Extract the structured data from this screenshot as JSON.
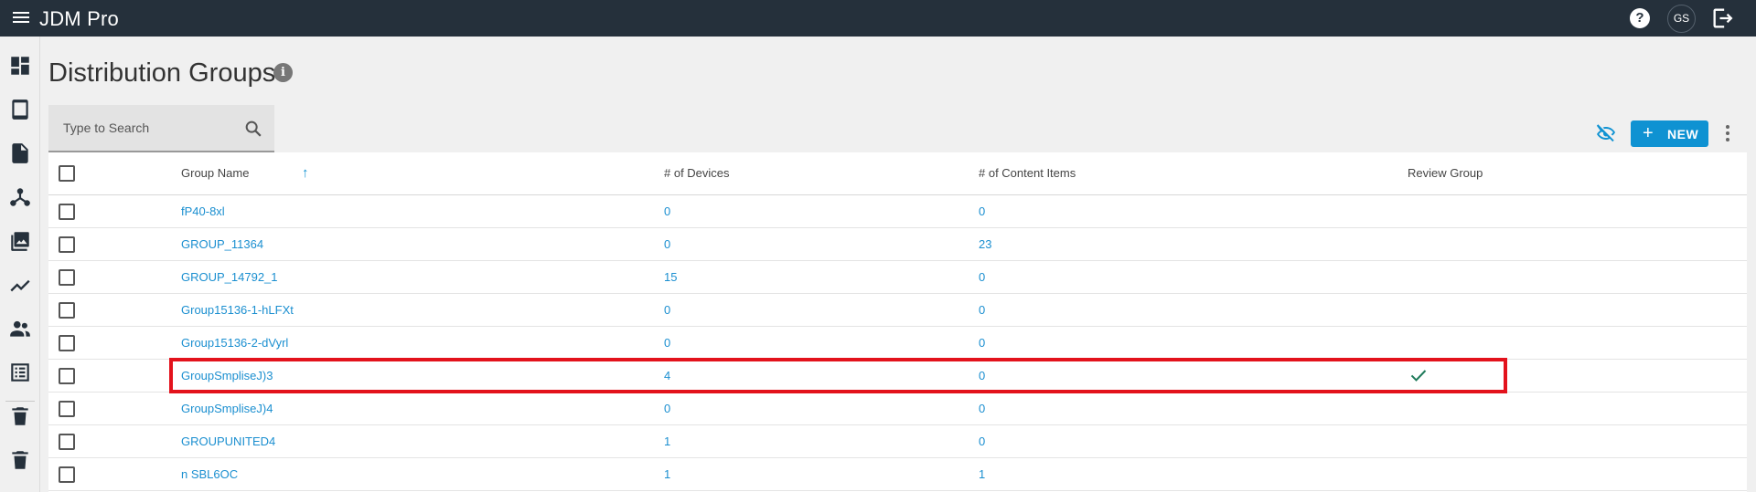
{
  "app": {
    "title": "JDM Pro",
    "user_initials": "GS"
  },
  "page": {
    "title": "Distribution Groups"
  },
  "search": {
    "placeholder": "Type to Search"
  },
  "toolbar": {
    "new_label": "NEW"
  },
  "table": {
    "columns": {
      "name": "Group Name",
      "devices": "# of Devices",
      "content": "# of Content Items",
      "review": "Review Group"
    },
    "rows": [
      {
        "name": "fP40-8xl",
        "devices": "0",
        "content": "0",
        "review": false
      },
      {
        "name": "GROUP_11364",
        "devices": "0",
        "content": "23",
        "review": false
      },
      {
        "name": "GROUP_14792_1",
        "devices": "15",
        "content": "0",
        "review": false
      },
      {
        "name": "Group15136-1-hLFXt",
        "devices": "0",
        "content": "0",
        "review": false
      },
      {
        "name": "Group15136-2-dVyrl",
        "devices": "0",
        "content": "0",
        "review": false
      },
      {
        "name": "GroupSmpliseJ)3",
        "devices": "4",
        "content": "0",
        "review": true
      },
      {
        "name": "GroupSmpliseJ)4",
        "devices": "0",
        "content": "0",
        "review": false
      },
      {
        "name": "GROUPUNITED4",
        "devices": "1",
        "content": "0",
        "review": false
      },
      {
        "name": "n SBL6OC",
        "devices": "1",
        "content": "1",
        "review": false
      }
    ]
  },
  "colors": {
    "topbar": "#25303b",
    "accent": "#0f92d2",
    "link": "#1b8fd0",
    "highlight": "#e3121c",
    "check": "#1e7a5a"
  },
  "icons": {
    "sidebar": [
      "dashboard-icon",
      "tablet-icon",
      "document-icon",
      "hierarchy-icon",
      "photos-icon",
      "analytics-icon",
      "people-icon",
      "list-icon",
      "trash-icon",
      "trash-icon"
    ],
    "top": [
      "menu-icon",
      "help-icon",
      "logout-icon"
    ]
  }
}
